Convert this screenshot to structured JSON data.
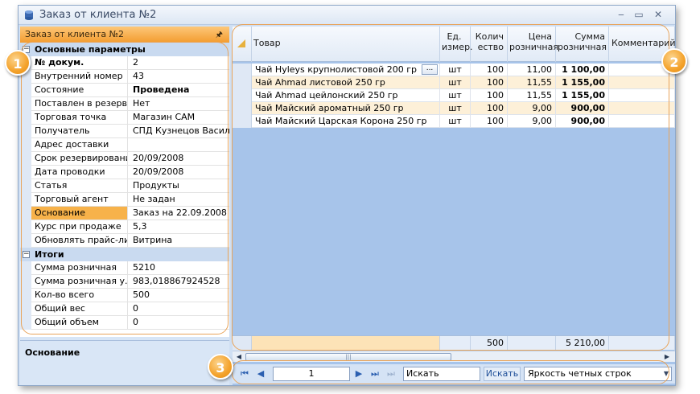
{
  "window": {
    "title": "Заказ от клиента №2",
    "controls": {
      "minimize": "‒",
      "maximize": "▭",
      "close": "✕"
    }
  },
  "left_panel": {
    "header": "Заказ от клиента №2",
    "pin_icon": "pin-icon",
    "categories": [
      {
        "title": "Основные параметры",
        "rows": [
          {
            "key": "№ докум.",
            "value": "2",
            "key_bold": true
          },
          {
            "key": "Внутренний номер",
            "value": "43"
          },
          {
            "key": "Состояние",
            "value": "Проведена",
            "value_bold": true
          },
          {
            "key": "Поставлен в резерв",
            "value": "Нет"
          },
          {
            "key": "Торговая точка",
            "value": "Магазин САМ"
          },
          {
            "key": "Получатель",
            "value": "СПД Кузнецов Василий"
          },
          {
            "key": "Адрес доставки",
            "value": ""
          },
          {
            "key": "Срок резервирования",
            "value": "20/09/2008"
          },
          {
            "key": "Дата проводки",
            "value": "20/09/2008"
          },
          {
            "key": "Статья",
            "value": "Продукты"
          },
          {
            "key": "Торговый агент",
            "value": "Не задан"
          },
          {
            "key": "Основание",
            "value": "Заказ на 22.09.2008",
            "selected": true
          },
          {
            "key": "Курс при продаже",
            "value": "5,3"
          },
          {
            "key": "Обновлять прайс-лист",
            "value": "Витрина"
          }
        ]
      },
      {
        "title": "Итоги",
        "rows": [
          {
            "key": "Сумма розничная",
            "value": "5210"
          },
          {
            "key": "Сумма розничная у.е.",
            "value": "983,018867924528"
          },
          {
            "key": "Кол-во всего",
            "value": "500"
          },
          {
            "key": "Общий вес",
            "value": "0"
          },
          {
            "key": "Общий объем",
            "value": "0"
          }
        ]
      }
    ],
    "description_title": "Основание"
  },
  "grid": {
    "columns": [
      {
        "label": "Товар"
      },
      {
        "label": "Ед. измер."
      },
      {
        "label": "Колич ество"
      },
      {
        "label": "Цена розничная"
      },
      {
        "label": "Сумма розничная"
      },
      {
        "label": "Комментарий"
      }
    ],
    "rows": [
      {
        "product": "Чай Hyleys крупнолистовой 200 гр",
        "unit": "шт",
        "qty": "100",
        "price": "11,00",
        "sum": "1 100,00",
        "comment": "",
        "has_button": true
      },
      {
        "product": "Чай Ahmad листовой 250 гр",
        "unit": "шт",
        "qty": "100",
        "price": "11,55",
        "sum": "1 155,00",
        "comment": ""
      },
      {
        "product": "Чай Ahmad цейлонский 250 гр",
        "unit": "шт",
        "qty": "100",
        "price": "11,55",
        "sum": "1 155,00",
        "comment": ""
      },
      {
        "product": "Чай Майский ароматный 250 гр",
        "unit": "шт",
        "qty": "100",
        "price": "9,00",
        "sum": "900,00",
        "comment": ""
      },
      {
        "product": "Чай Майский Царская Корона 250 гр",
        "unit": "шт",
        "qty": "100",
        "price": "9,00",
        "sum": "900,00",
        "comment": ""
      }
    ],
    "dots_label": "...",
    "footer": {
      "qty_total": "500",
      "sum_total": "5 210,00"
    }
  },
  "navigator": {
    "page": "1",
    "search_value": "Искать",
    "search_button": "Искать",
    "combo_value": "Яркость четных строк"
  },
  "annotations": {
    "b1": "1",
    "b2": "2",
    "b3": "3"
  },
  "colors": {
    "accent_orange": "#f39c2f",
    "grid_bg": "#a7c4ea",
    "row_alt": "#fdf0d8"
  }
}
